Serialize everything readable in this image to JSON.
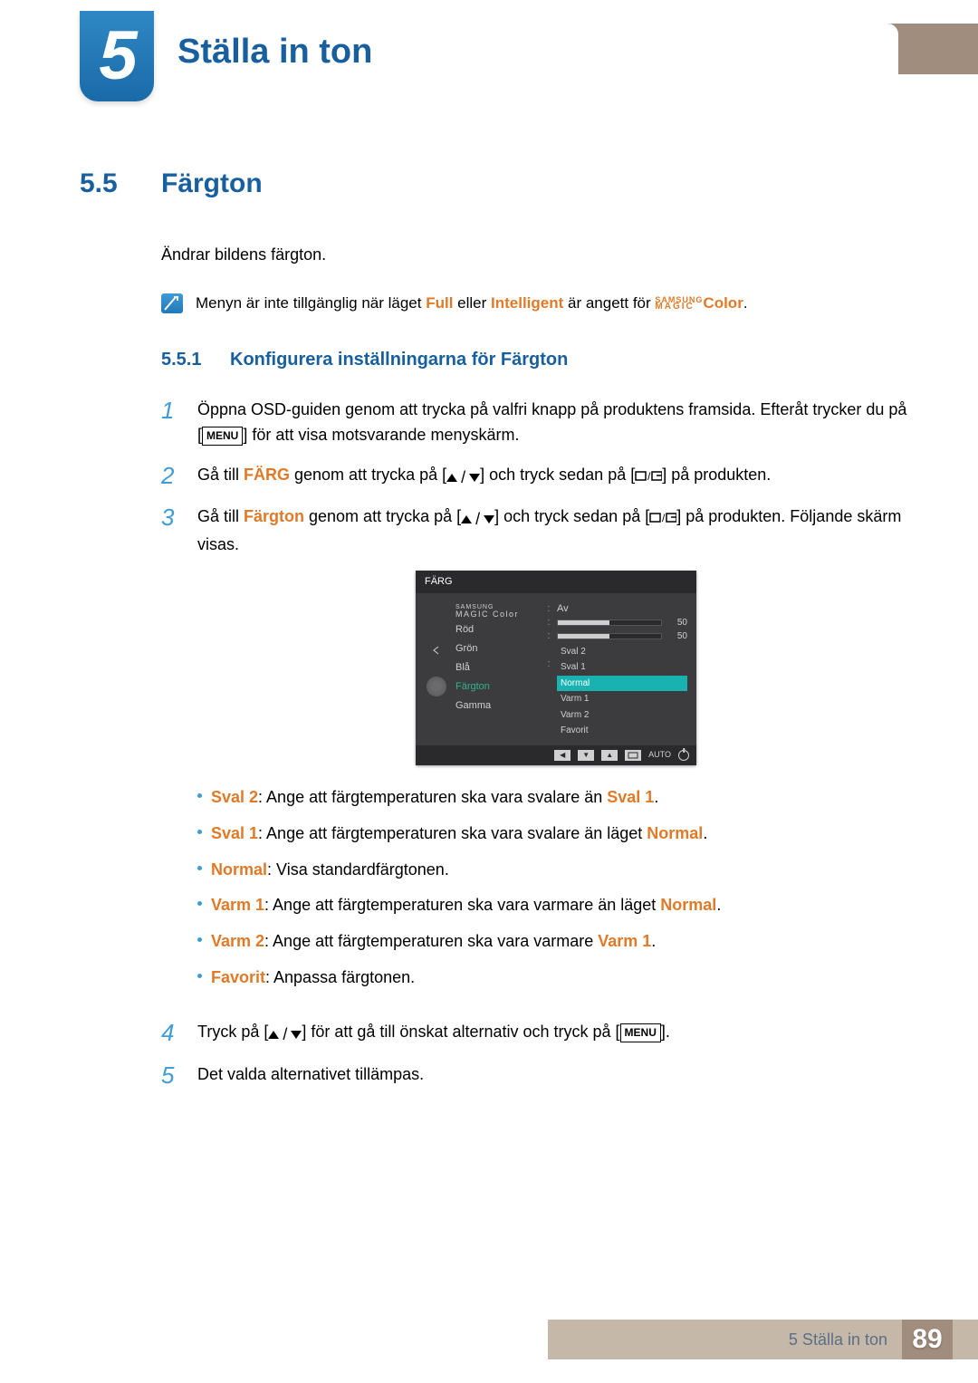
{
  "chapter": {
    "number": "5",
    "title": "Ställa in ton"
  },
  "section": {
    "number": "5.5",
    "title": "Färgton"
  },
  "intro": "Ändrar bildens färgton.",
  "note": {
    "pre": "Menyn är inte tillgänglig när läget ",
    "full": "Full",
    "mid": " eller ",
    "intelligent": "Intelligent",
    "post1": " är angett för ",
    "magic_top": "SAMSUNG",
    "magic_bot": "MAGIC",
    "magic_after": "Color",
    "end": "."
  },
  "subsection": {
    "number": "5.5.1",
    "title": "Konfigurera inställningarna för Färgton"
  },
  "steps": {
    "s1": {
      "a": "Öppna OSD-guiden genom att trycka på valfri knapp på produktens framsida. Efteråt trycker du på [",
      "menu": "MENU",
      "b": "] för att visa motsvarande menyskärm."
    },
    "s2": {
      "a": "Gå till ",
      "farg": "FÄRG",
      "b": " genom att trycka på [",
      "c": "] och tryck sedan på [",
      "d": "] på produkten."
    },
    "s3": {
      "a": "Gå till ",
      "fargton": "Färgton",
      "b": " genom att trycka på [",
      "c": "] och tryck sedan på [",
      "d": "] på produkten. Följande skärm visas."
    },
    "s4": {
      "a": "Tryck på [",
      "b": "] för att gå till önskat alternativ och tryck på [",
      "menu": "MENU",
      "c": "]."
    },
    "s5": "Det valda alternativet tillämpas."
  },
  "step_numbers": {
    "n1": "1",
    "n2": "2",
    "n3": "3",
    "n4": "4",
    "n5": "5"
  },
  "osd": {
    "title": "FÄRG",
    "magic_top": "SAMSUNG",
    "magic_bot": "MAGIC",
    "magic_label": "Color",
    "labels": {
      "rod": "Röd",
      "gron": "Grön",
      "bla": "Blå",
      "fargton": "Färgton",
      "gamma": "Gamma"
    },
    "av": "Av",
    "value50": "50",
    "options": {
      "o0": "Sval 2",
      "o1": "Sval 1",
      "o2": "Normal",
      "o3": "Varm 1",
      "o4": "Varm 2",
      "o5": "Favorit"
    },
    "auto": "AUTO"
  },
  "descs": {
    "d0": {
      "k": "Sval 2",
      "t1": ": Ange att färgtemperaturen ska vara svalare än ",
      "k2": "Sval 1",
      "t2": "."
    },
    "d1": {
      "k": "Sval 1",
      "t1": ": Ange att färgtemperaturen ska vara svalare än läget ",
      "k2": "Normal",
      "t2": "."
    },
    "d2": {
      "k": "Normal",
      "t1": ": Visa standardfärgtonen.",
      "k2": "",
      "t2": ""
    },
    "d3": {
      "k": "Varm 1",
      "t1": ": Ange att färgtemperaturen ska vara varmare än läget ",
      "k2": "Normal",
      "t2": "."
    },
    "d4": {
      "k": "Varm 2",
      "t1": ": Ange att färgtemperaturen ska vara varmare ",
      "k2": "Varm 1",
      "t2": "."
    },
    "d5": {
      "k": "Favorit",
      "t1": ": Anpassa färgtonen.",
      "k2": "",
      "t2": ""
    }
  },
  "footer": {
    "chapter": "5 Ställa in ton",
    "page": "89"
  }
}
